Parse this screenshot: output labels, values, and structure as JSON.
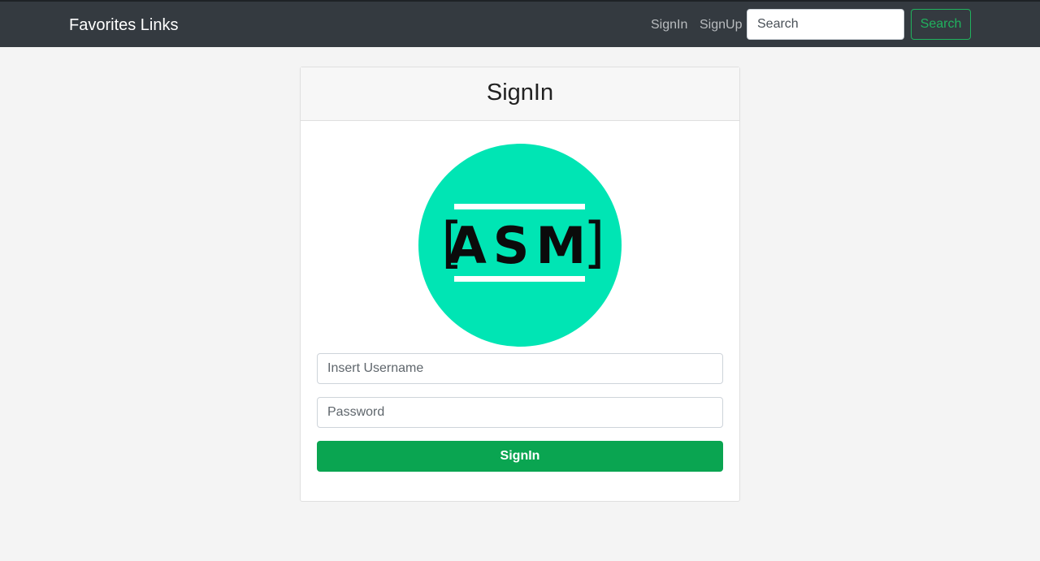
{
  "navbar": {
    "brand": "Favorites Links",
    "links": [
      {
        "label": "SignIn"
      },
      {
        "label": "SignUp"
      }
    ],
    "search": {
      "placeholder": "Search",
      "button_label": "Search"
    }
  },
  "card": {
    "title": "SignIn",
    "logo": {
      "text": "ASM",
      "left_bracket": "[",
      "right_bracket": "]",
      "color": "#00e5b4"
    },
    "username": {
      "placeholder": "Insert Username",
      "value": ""
    },
    "password": {
      "placeholder": "Password",
      "value": ""
    },
    "submit_label": "SignIn"
  },
  "colors": {
    "navbar_bg": "#343a40",
    "accent_green": "#20b25e",
    "button_green": "#0aa551",
    "logo_teal": "#00e5b4"
  }
}
